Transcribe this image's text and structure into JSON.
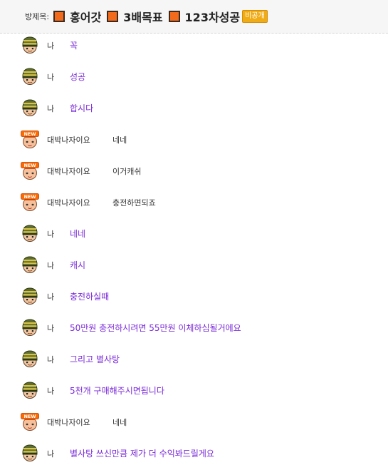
{
  "header": {
    "room_label": "방제목:",
    "title_parts": [
      "홍어갓",
      "3배목표",
      "123차성공"
    ],
    "private_badge": "비공개"
  },
  "colors": {
    "accent": "#7a2ad8",
    "title_square": "#f26b1d",
    "badge": "#f0ac16"
  },
  "messages": [
    {
      "sender": "나",
      "is_me": true,
      "avatar_icon": "helmet-avatar-icon",
      "text": "꼭"
    },
    {
      "sender": "나",
      "is_me": true,
      "avatar_icon": "helmet-avatar-icon",
      "text": "성공"
    },
    {
      "sender": "나",
      "is_me": true,
      "avatar_icon": "helmet-avatar-icon",
      "text": "합시다"
    },
    {
      "sender": "대박나자이요",
      "is_me": false,
      "avatar_icon": "new-avatar-icon",
      "text": "네네"
    },
    {
      "sender": "대박나자이요",
      "is_me": false,
      "avatar_icon": "new-avatar-icon",
      "text": "이거캐쉬"
    },
    {
      "sender": "대박나자이요",
      "is_me": false,
      "avatar_icon": "new-avatar-icon",
      "text": "충전하면되죠"
    },
    {
      "sender": "나",
      "is_me": true,
      "avatar_icon": "helmet-avatar-icon",
      "text": "네네"
    },
    {
      "sender": "나",
      "is_me": true,
      "avatar_icon": "helmet-avatar-icon",
      "text": "캐시"
    },
    {
      "sender": "나",
      "is_me": true,
      "avatar_icon": "helmet-avatar-icon",
      "text": "충전하실때"
    },
    {
      "sender": "나",
      "is_me": true,
      "avatar_icon": "helmet-avatar-icon",
      "text": "50만원 충전하시려면 55만원 이체하심될거에요"
    },
    {
      "sender": "나",
      "is_me": true,
      "avatar_icon": "helmet-avatar-icon",
      "text": "그리고 별사탕"
    },
    {
      "sender": "나",
      "is_me": true,
      "avatar_icon": "helmet-avatar-icon",
      "text": "5천개 구매해주시면됩니다"
    },
    {
      "sender": "대박나자이요",
      "is_me": false,
      "avatar_icon": "new-avatar-icon",
      "text": "네네"
    },
    {
      "sender": "나",
      "is_me": true,
      "avatar_icon": "helmet-avatar-icon",
      "text": "별사탕 쓰신만큼 제가 더 수익봐드릴게요"
    }
  ]
}
